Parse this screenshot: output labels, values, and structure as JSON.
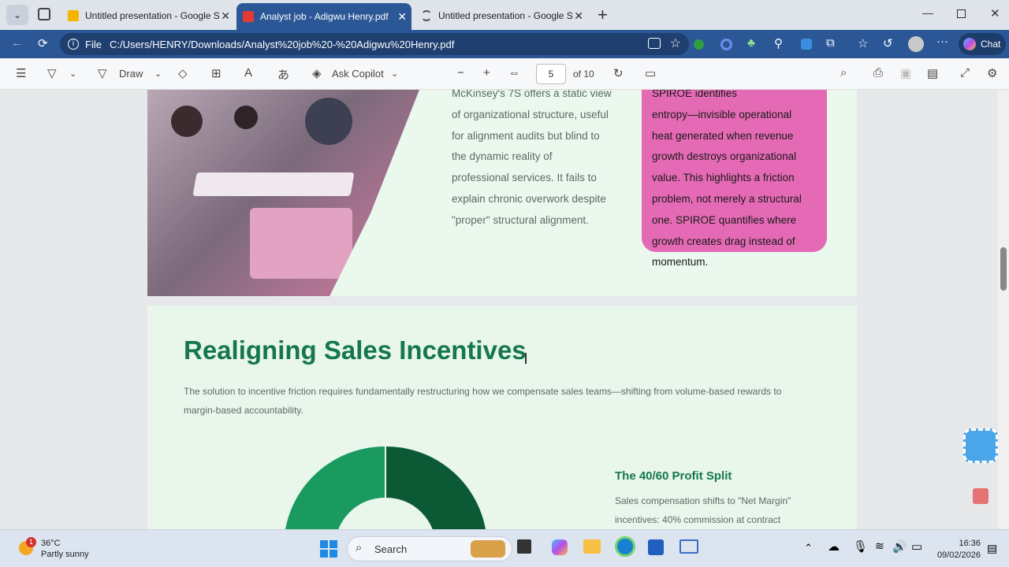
{
  "tabs": [
    {
      "label": "Untitled presentation - Google Slides",
      "active": false
    },
    {
      "label": "Analyst job - Adigwu Henry.pdf",
      "active": true
    },
    {
      "label": "Untitled presentation - Google Slides",
      "active": false
    }
  ],
  "address": {
    "scheme": "File",
    "url": "C:/Users/HENRY/Downloads/Analyst%20job%20-%20Adigwu%20Henry.pdf"
  },
  "browser": {
    "chat_label": "Chat"
  },
  "pdf_toolbar": {
    "draw_label": "Draw",
    "copilot_label": "Ask Copilot",
    "page": "5",
    "page_of": "of 10"
  },
  "page_top": {
    "body_lines": [
      "McKinsey's 7S offers a static view",
      "of organizational structure, useful",
      "for alignment audits but blind to",
      "the dynamic reality of",
      "professional services. It fails to",
      "explain chronic overwork despite",
      "\"proper\" structural alignment."
    ],
    "pink_lines": [
      "SPIROE identifies",
      "entropy—invisible operational",
      "heat generated when revenue",
      "growth destroys organizational",
      "value. This highlights a friction",
      "problem, not merely a structural",
      "one. SPIROE quantifies where",
      "growth creates drag instead of",
      "momentum."
    ]
  },
  "page_next": {
    "heading": "Realigning Sales Incentives",
    "paragraph": "The solution to incentive friction requires fundamentally restructuring how we compensate sales teams—shifting from volume-based rewards to margin-based accountability.",
    "subheading": "The 40/60 Profit Split",
    "sub_lines": [
      "Sales compensation shifts to \"Net Margin\"",
      "incentives: 40% commission at contract"
    ]
  },
  "colors": {
    "heading_green": "#15774a",
    "pink": "#e56ab5",
    "donut_dark": "#0b5a35",
    "donut_light": "#1a9a5f"
  },
  "taskbar": {
    "temp": "36°C",
    "weather": "Partly sunny",
    "search": "Search",
    "time": "16:36",
    "date": "09/02/2026",
    "notif_count": "1"
  }
}
